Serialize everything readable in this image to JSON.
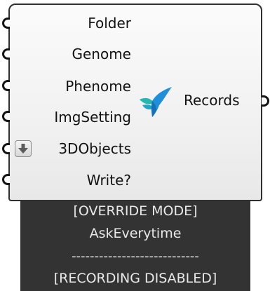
{
  "component": {
    "inputs": [
      {
        "label": "Folder"
      },
      {
        "label": "Genome"
      },
      {
        "label": "Phenome"
      },
      {
        "label": "ImgSetting"
      },
      {
        "label": "3DObjects",
        "icon": "arrow-down-icon"
      },
      {
        "label": "Write?"
      }
    ],
    "output": {
      "label": "Records"
    },
    "logo_icon": "hummingbird-icon"
  },
  "status_panel": {
    "mode_line": "[OVERRIDE MODE]",
    "mode_value": "AskEverytime",
    "separator": "----------------------------",
    "recording_status": "[RECORDING DISABLED]"
  },
  "colors": {
    "body_fill": "#f1f1f1",
    "panel_fill": "#3f3f3f",
    "outline": "#303030",
    "logo_blue": "#1e8fd8",
    "logo_teal": "#22b3b3"
  }
}
